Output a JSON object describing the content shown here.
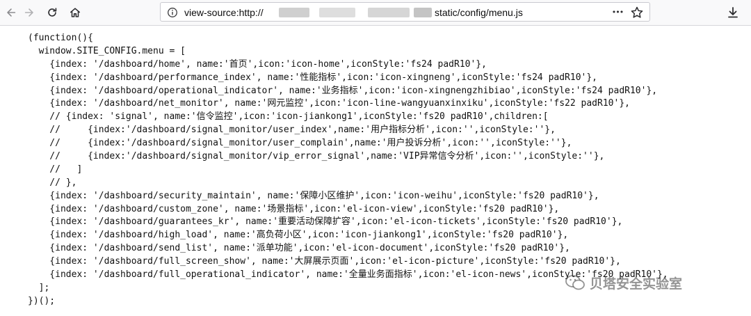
{
  "browser": {
    "url_prefix": "view-source:http://",
    "url_suffix": "static/config/menu.js",
    "more_label": "•••",
    "redact_colors": [
      "#c9c9c9",
      "#dcdcdc",
      "#cfcfcf",
      "#bdbdbd"
    ]
  },
  "source": {
    "lines": [
      "(function(){",
      "  window.SITE_CONFIG.menu = [",
      "    {index: '/dashboard/home', name:'首页',icon:'icon-home',iconStyle:'fs24 padR10'},",
      "    {index: '/dashboard/performance_index', name:'性能指标',icon:'icon-xingneng',iconStyle:'fs24 padR10'},",
      "    {index: '/dashboard/operational_indicator', name:'业务指标',icon:'icon-xingnengzhibiao',iconStyle:'fs24 padR10'},",
      "    {index: '/dashboard/net_monitor', name:'网元监控',icon:'icon-line-wangyuanxinxiku',iconStyle:'fs22 padR10'},",
      "    // {index: 'signal', name:'信令监控',icon:'icon-jiankong1',iconStyle:'fs20 padR10',children:[",
      "    //     {index:'/dashboard/signal_monitor/user_index',name:'用户指标分析',icon:'',iconStyle:''},",
      "    //     {index:'/dashboard/signal_monitor/user_complain',name:'用户投诉分析',icon:'',iconStyle:''},",
      "    //     {index:'/dashboard/signal_monitor/vip_error_signal',name:'VIP异常信令分析',icon:'',iconStyle:''},",
      "    //   ]",
      "    // },",
      "    {index: '/dashboard/security_maintain', name:'保障小区维护',icon:'icon-weihu',iconStyle:'fs20 padR10'},",
      "    {index: '/dashboard/custom_zone', name:'场景指标',icon:'el-icon-view',iconStyle:'fs20 padR10'},",
      "    {index: '/dashboard/guarantees_kr', name:'重要活动保障扩容',icon:'el-icon-tickets',iconStyle:'fs20 padR10'},",
      "    {index: '/dashboard/high_load', name:'高负荷小区',icon:'icon-jiankong1',iconStyle:'fs20 padR10'},",
      "    {index: '/dashboard/send_list', name:'派单功能',icon:'el-icon-document',iconStyle:'fs20 padR10'},",
      "    {index: '/dashboard/full_screen_show', name:'大屏展示页面',icon:'el-icon-picture',iconStyle:'fs20 padR10'},",
      "    {index: '/dashboard/full_operational_indicator', name:'全量业务面指标',icon:'el-icon-news',iconStyle:'fs20 padR10'},",
      "  ];",
      "})();"
    ]
  },
  "watermark": {
    "text": "贝塔安全实验室"
  }
}
